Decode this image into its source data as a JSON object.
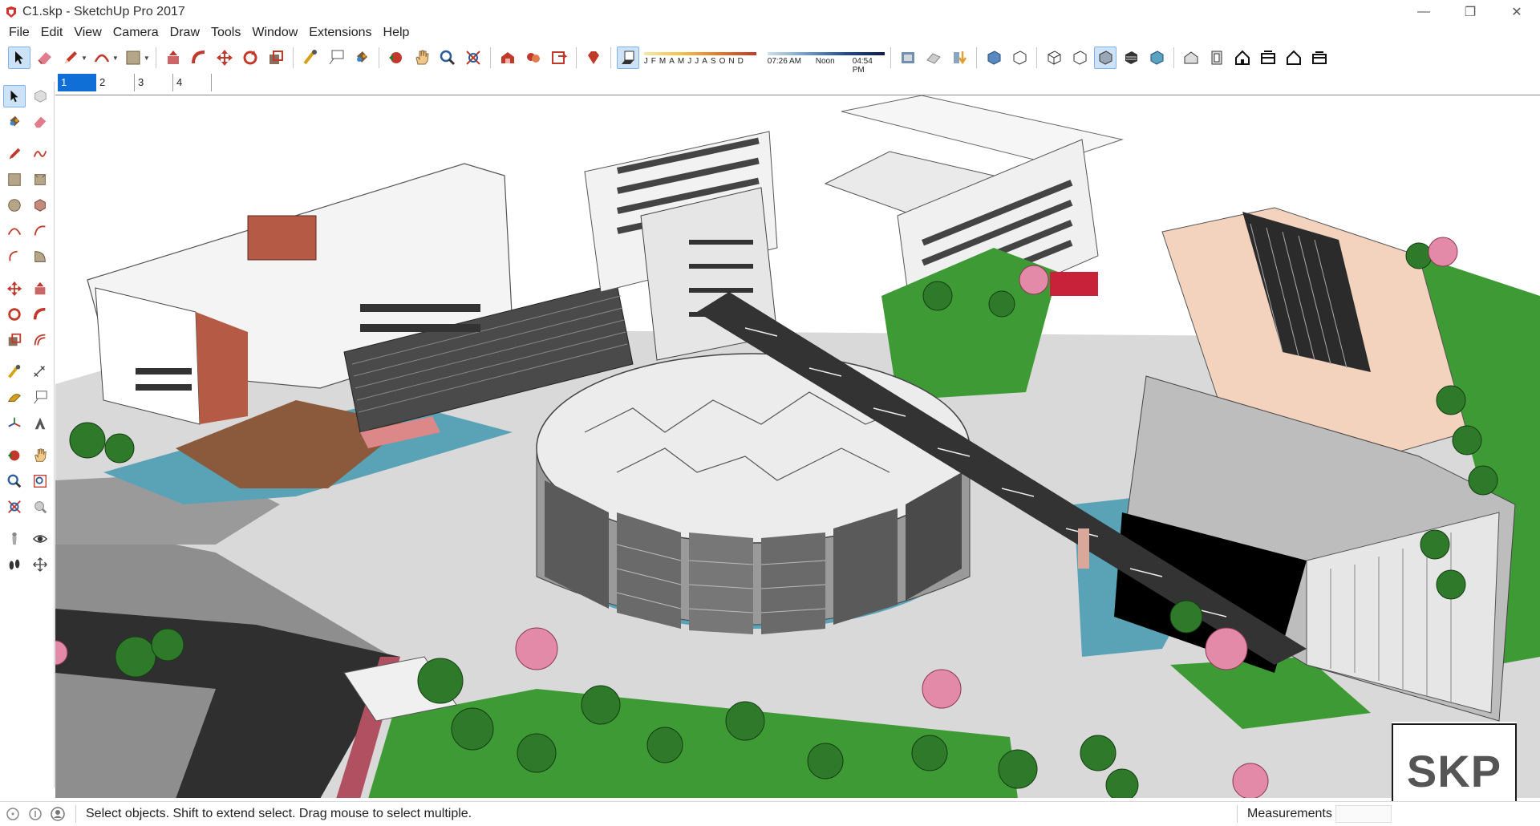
{
  "window": {
    "title": "C1.skp - SketchUp Pro 2017",
    "controls": {
      "minimize": "—",
      "restore": "❐",
      "close": "✕"
    }
  },
  "menu": [
    "File",
    "Edit",
    "View",
    "Camera",
    "Draw",
    "Tools",
    "Window",
    "Extensions",
    "Help"
  ],
  "toolbar": {
    "shadow_settings": {
      "months": [
        "J",
        "F",
        "M",
        "A",
        "M",
        "J",
        "J",
        "A",
        "S",
        "O",
        "N",
        "D"
      ],
      "time_start": "07:26 AM",
      "time_mid": "Noon",
      "time_end": "04:54 PM"
    }
  },
  "scenes": [
    "1",
    "2",
    "3",
    "4"
  ],
  "active_scene": "1",
  "status": {
    "hint": "Select objects. Shift to extend select. Drag mouse to select multiple.",
    "measurements_label": "Measurements",
    "measurements_value": ""
  },
  "logo": {
    "text": "SKP"
  },
  "colors": {
    "accent": "#0f6fd6",
    "water": "#5aa3b7",
    "lawn": "#3e9a35",
    "road": "#2f2f2f",
    "blossom": "#e38aa8",
    "terracotta": "#b55a45"
  }
}
